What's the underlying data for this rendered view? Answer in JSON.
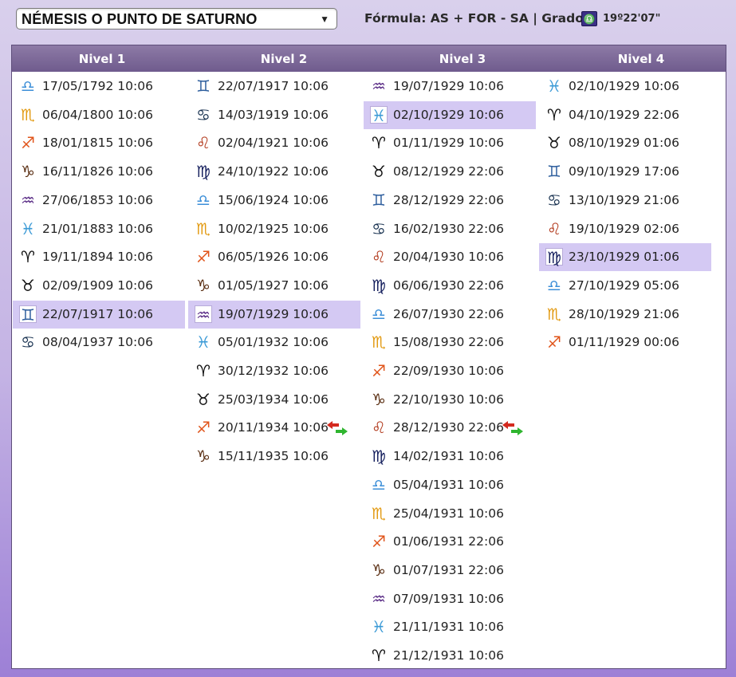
{
  "selector": {
    "value": "NÉMESIS O PUNTO DE SATURNO"
  },
  "formula_text": "Fórmula: AS + FOR - SA | Grado:",
  "grado": {
    "sign": "libra",
    "glyph": "♎",
    "value": "19º22'07\""
  },
  "levels": [
    "Nivel 1",
    "Nivel 2",
    "Nivel 3",
    "Nivel 4"
  ],
  "sign_colors": {
    "aries": "#111111",
    "taurus": "#111111",
    "gemini": "#2f5f9e",
    "cancer": "#1c3553",
    "leo": "#b23a1d",
    "virgo": "#16205e",
    "libra": "#3d8fd8",
    "scorpio": "#e29a12",
    "sagittarius": "#e0541a",
    "capricorn": "#5a2e12",
    "aquarius": "#5a2c86",
    "pisces": "#3b9ad6"
  },
  "sign_glyphs": {
    "aries": "♈",
    "taurus": "♉",
    "gemini": "♊",
    "cancer": "♋",
    "leo": "♌",
    "virgo": "♍",
    "libra": "♎",
    "scorpio": "♏",
    "sagittarius": "♐",
    "capricorn": "♑",
    "aquarius": "♒",
    "pisces": "♓"
  },
  "columns": [
    [
      {
        "sign": "libra",
        "date": "17/05/1792 10:06"
      },
      {
        "sign": "scorpio",
        "date": "06/04/1800 10:06"
      },
      {
        "sign": "sagittarius",
        "date": "18/01/1815 10:06"
      },
      {
        "sign": "capricorn",
        "date": "16/11/1826 10:06"
      },
      {
        "sign": "aquarius",
        "date": "27/06/1853 10:06"
      },
      {
        "sign": "pisces",
        "date": "21/01/1883 10:06"
      },
      {
        "sign": "aries",
        "date": "19/11/1894 10:06"
      },
      {
        "sign": "taurus",
        "date": "02/09/1909 10:06"
      },
      {
        "sign": "gemini",
        "date": "22/07/1917 10:06",
        "selected": true
      },
      {
        "sign": "cancer",
        "date": "08/04/1937 10:06"
      }
    ],
    [
      {
        "sign": "gemini",
        "date": "22/07/1917 10:06"
      },
      {
        "sign": "cancer",
        "date": "14/03/1919 10:06"
      },
      {
        "sign": "leo",
        "date": "02/04/1921 10:06"
      },
      {
        "sign": "virgo",
        "date": "24/10/1922 10:06"
      },
      {
        "sign": "libra",
        "date": "15/06/1924 10:06"
      },
      {
        "sign": "scorpio",
        "date": "10/02/1925 10:06"
      },
      {
        "sign": "sagittarius",
        "date": "06/05/1926 10:06"
      },
      {
        "sign": "capricorn",
        "date": "01/05/1927 10:06"
      },
      {
        "sign": "aquarius",
        "date": "19/07/1929 10:06",
        "selected": true
      },
      {
        "sign": "pisces",
        "date": "05/01/1932 10:06"
      },
      {
        "sign": "aries",
        "date": "30/12/1932 10:06"
      },
      {
        "sign": "taurus",
        "date": "25/03/1934 10:06"
      },
      {
        "sign": "sagittarius",
        "date": "20/11/1934 10:06",
        "retro": true
      },
      {
        "sign": "capricorn",
        "date": "15/11/1935 10:06"
      }
    ],
    [
      {
        "sign": "aquarius",
        "date": "19/07/1929 10:06"
      },
      {
        "sign": "pisces",
        "date": "02/10/1929 10:06",
        "selected": true
      },
      {
        "sign": "aries",
        "date": "01/11/1929 10:06"
      },
      {
        "sign": "taurus",
        "date": "08/12/1929 22:06"
      },
      {
        "sign": "gemini",
        "date": "28/12/1929 22:06"
      },
      {
        "sign": "cancer",
        "date": "16/02/1930 22:06"
      },
      {
        "sign": "leo",
        "date": "20/04/1930 10:06"
      },
      {
        "sign": "virgo",
        "date": "06/06/1930 22:06"
      },
      {
        "sign": "libra",
        "date": "26/07/1930 22:06"
      },
      {
        "sign": "scorpio",
        "date": "15/08/1930 22:06"
      },
      {
        "sign": "sagittarius",
        "date": "22/09/1930 10:06"
      },
      {
        "sign": "capricorn",
        "date": "22/10/1930 10:06"
      },
      {
        "sign": "leo",
        "date": "28/12/1930 22:06",
        "retro": true
      },
      {
        "sign": "virgo",
        "date": "14/02/1931 10:06"
      },
      {
        "sign": "libra",
        "date": "05/04/1931 10:06"
      },
      {
        "sign": "scorpio",
        "date": "25/04/1931 10:06"
      },
      {
        "sign": "sagittarius",
        "date": "01/06/1931 22:06"
      },
      {
        "sign": "capricorn",
        "date": "01/07/1931 22:06"
      },
      {
        "sign": "aquarius",
        "date": "07/09/1931 10:06"
      },
      {
        "sign": "pisces",
        "date": "21/11/1931 10:06"
      },
      {
        "sign": "aries",
        "date": "21/12/1931 10:06"
      }
    ],
    [
      {
        "sign": "pisces",
        "date": "02/10/1929 10:06"
      },
      {
        "sign": "aries",
        "date": "04/10/1929 22:06"
      },
      {
        "sign": "taurus",
        "date": "08/10/1929 01:06"
      },
      {
        "sign": "gemini",
        "date": "09/10/1929 17:06"
      },
      {
        "sign": "cancer",
        "date": "13/10/1929 21:06"
      },
      {
        "sign": "leo",
        "date": "19/10/1929 02:06"
      },
      {
        "sign": "virgo",
        "date": "23/10/1929 01:06",
        "selected": true
      },
      {
        "sign": "libra",
        "date": "27/10/1929 05:06"
      },
      {
        "sign": "scorpio",
        "date": "28/10/1929 21:06"
      },
      {
        "sign": "sagittarius",
        "date": "01/11/1929 00:06"
      }
    ]
  ]
}
